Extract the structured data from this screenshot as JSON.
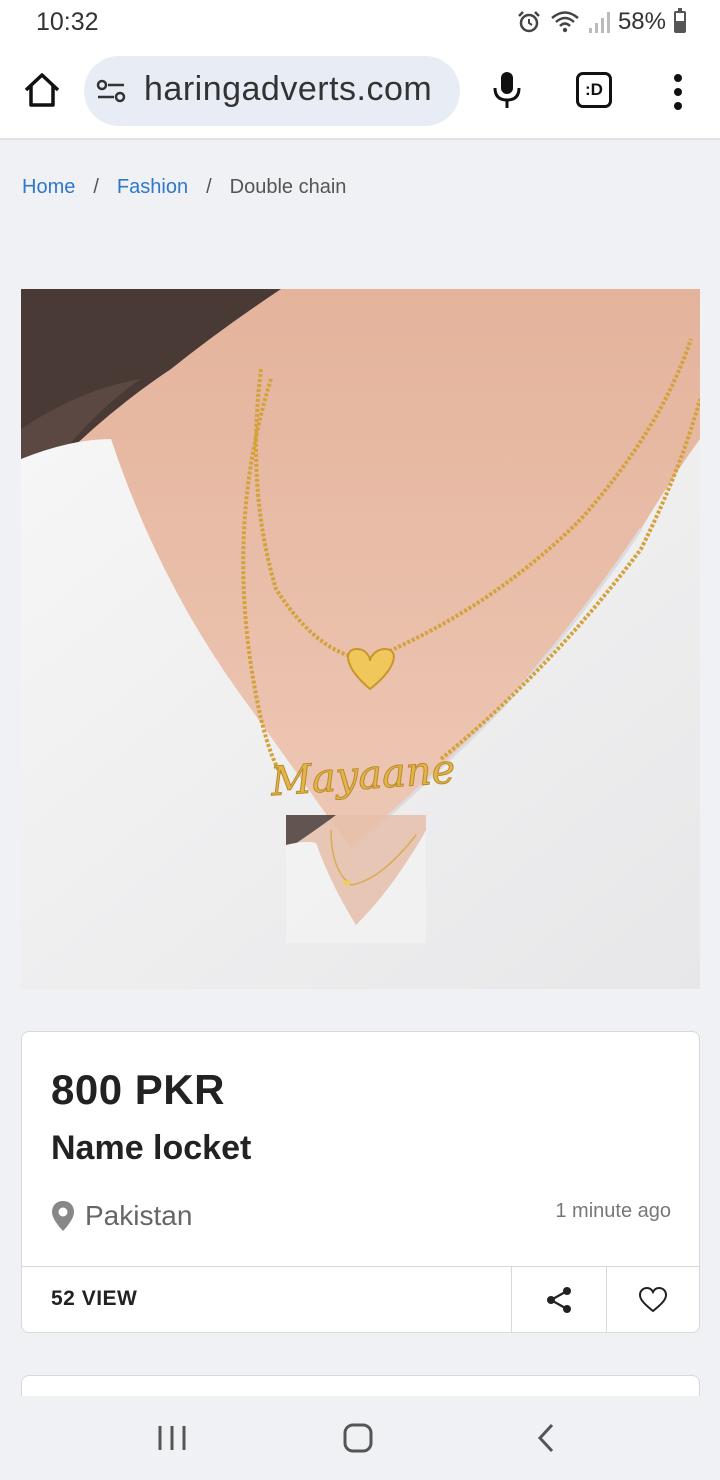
{
  "status_bar": {
    "time": "10:32",
    "battery": "58%",
    "battery_level": 0.58
  },
  "browser": {
    "url": "haringadverts.com",
    "tab_label": ":D"
  },
  "breadcrumb": {
    "home": "Home",
    "category": "Fashion",
    "current": "Double chain"
  },
  "pendant_text": "Mayaane",
  "listing": {
    "price": "800 PKR",
    "title": "Name locket",
    "location": "Pakistan",
    "posted": "1 minute ago",
    "views": "52 VIEW"
  },
  "icons": [
    "alarm-icon",
    "wifi-icon",
    "signal-icon",
    "battery-icon",
    "home-icon",
    "tune-icon",
    "mic-icon",
    "more-vert-icon",
    "location-pin-icon",
    "share-icon",
    "heart-icon",
    "recent-apps-icon",
    "nav-home-icon",
    "back-icon"
  ],
  "colors": {
    "link": "#2f78c8",
    "url_pill": "#e8ecf5",
    "gold": "#d4a23a"
  }
}
